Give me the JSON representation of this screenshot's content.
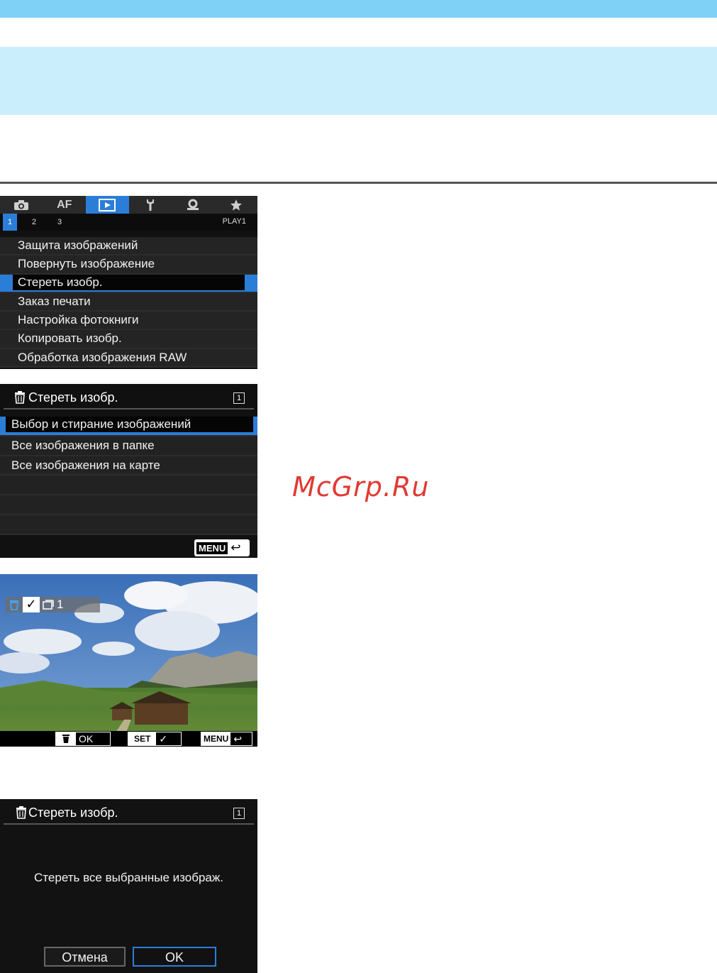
{
  "watermark": "McGrp.Ru",
  "screen1": {
    "tabs": [
      "AF"
    ],
    "subtabs": [
      "1",
      "2",
      "3"
    ],
    "page_code": "PLAY1",
    "items": [
      "Защита изображений",
      "Повернуть изображение",
      "Стереть изобр.",
      "Заказ печати",
      "Настройка фотокниги",
      "Копировать изобр.",
      "Обработка изображения RAW"
    ],
    "selected_index": 2
  },
  "screen2": {
    "title": "Стереть изобр.",
    "info": "1",
    "options": [
      "Выбор и стирание изображений",
      "Все изображения в папке",
      "Все изображения на карте"
    ],
    "menu_button": "MENU"
  },
  "screen3": {
    "check_mark": "✓",
    "count": "1",
    "buttons": {
      "erase_ok": "OK",
      "set": "SET",
      "set_check": "✓",
      "menu": "MENU"
    }
  },
  "screen4": {
    "title": "Стереть изобр.",
    "info": "1",
    "message": "Стереть все выбранные изображ.",
    "cancel": "Отмена",
    "ok": "OK"
  },
  "colors": {
    "header_bar": "#7fd2f5",
    "header_band": "#cbeefc",
    "menu_highlight": "#2b7ed8",
    "watermark": "#e03a32"
  }
}
